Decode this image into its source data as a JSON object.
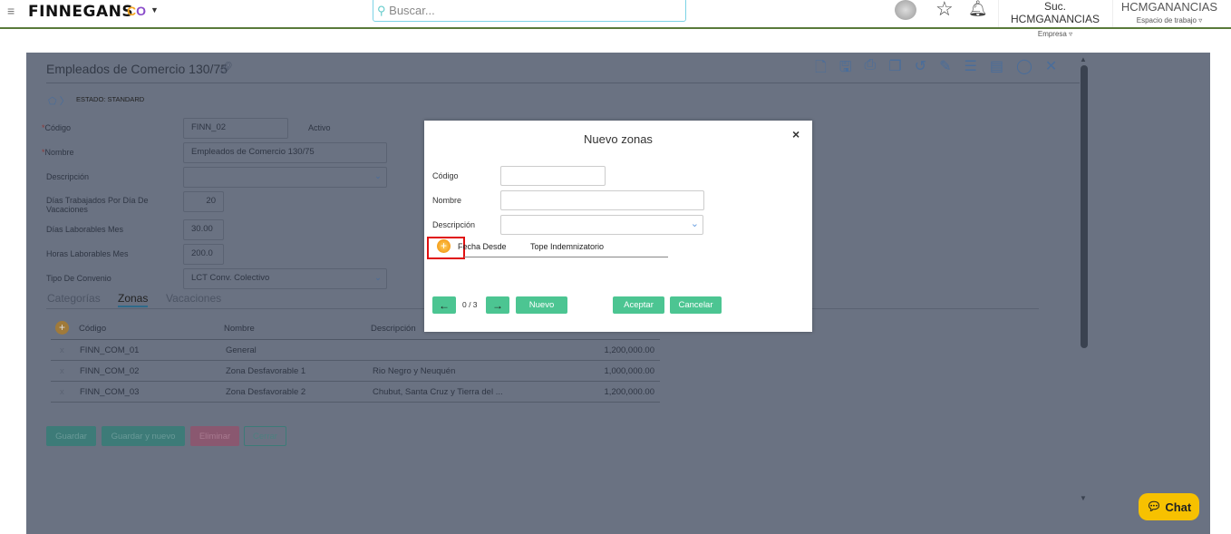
{
  "header": {
    "brand": "FINNEGANS",
    "search_placeholder": "Buscar...",
    "company": "Suc. HCMGANANCIAS",
    "company_label": "Empresa",
    "workspace": "HCMGANANCIAS",
    "workspace_label": "Espacio de trabajo"
  },
  "form": {
    "title": "Empleados de Comercio 130/75",
    "status": "ESTADO: STANDARD",
    "fields": {
      "codigo_label": "Código",
      "codigo": "FINN_02",
      "activo_label": "Activo",
      "nombre_label": "Nombre",
      "nombre": "Empleados de Comercio 130/75",
      "descripcion_label": "Descripción",
      "dias_trab_label": "Días Trabajados Por Día De Vacaciones",
      "dias_trab": "20",
      "dias_lab_label": "Días Laborables Mes",
      "dias_lab": "30.00",
      "horas_lab_label": "Horas Laborables Mes",
      "horas_lab": "200.0",
      "tipo_conv_label": "Tipo De Convenio",
      "tipo_conv": "LCT Conv. Colectivo"
    },
    "tabs": [
      "Categorías",
      "Zonas",
      "Vacaciones"
    ],
    "table": {
      "headers": [
        "Código",
        "Nombre",
        "Descripción"
      ],
      "rows": [
        [
          "FINN_COM_01",
          "General",
          "",
          "1,200,000.00"
        ],
        [
          "FINN_COM_02",
          "Zona Desfavorable 1",
          "Rio Negro y Neuquén",
          "1,000,000.00"
        ],
        [
          "FINN_COM_03",
          "Zona Desfavorable 2",
          "Chubut, Santa Cruz y Tierra del ...",
          "1,200,000.00"
        ]
      ]
    },
    "buttons": {
      "guardar": "Guardar",
      "guardar_nuevo": "Guardar y nuevo",
      "eliminar": "Eliminar",
      "cerrar": "Cerrar"
    }
  },
  "modal": {
    "title": "Nuevo zonas",
    "close": "×",
    "codigo_label": "Código",
    "nombre_label": "Nombre",
    "descripcion_label": "Descripción",
    "grid_headers": [
      "Fecha Desde",
      "Tope Indemnizatorio"
    ],
    "pager": "0 / 3",
    "nuevo": "Nuevo",
    "aceptar": "Aceptar",
    "cancelar": "Cancelar"
  },
  "chat": {
    "label": "Chat"
  }
}
